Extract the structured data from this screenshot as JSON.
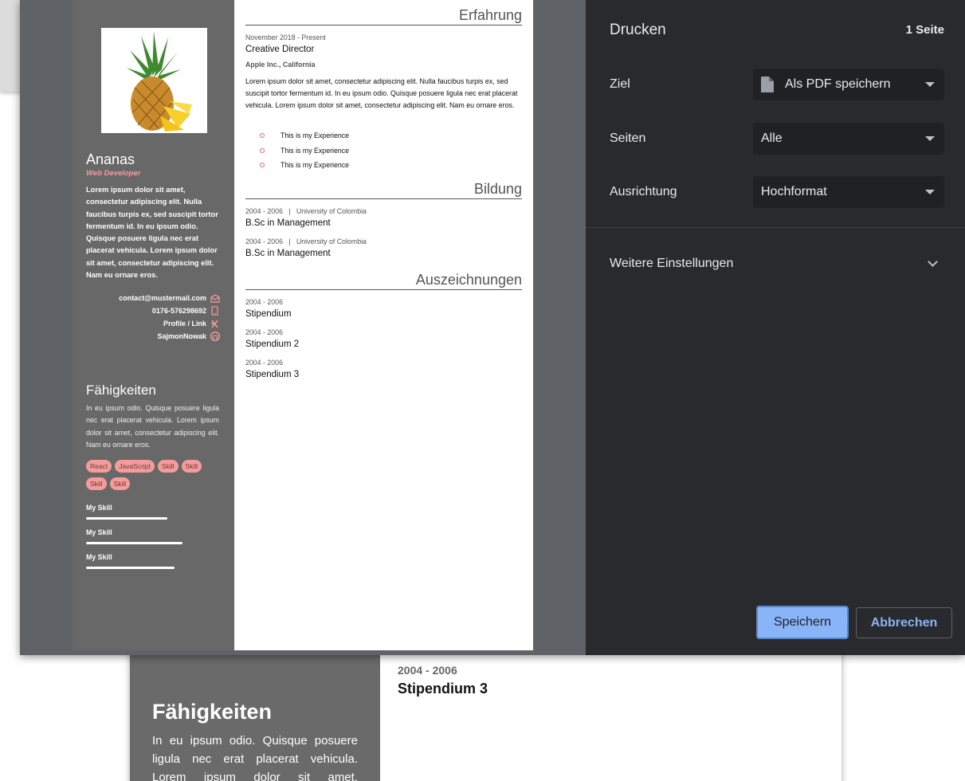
{
  "background_page": {
    "skills_title": "Fähigkeiten",
    "skills_text": "In eu ipsum odio. Quisque posuere ligula nec erat placerat vehicula. Lorem ipsum dolor sit amet, consectetur",
    "date": "2004 - 2006",
    "title": "Stipendium 3"
  },
  "cv": {
    "sidebar": {
      "name": "Ananas",
      "role": "Web Developer",
      "about": "Lorem ipsum dolor sit amet, consectetur adipiscing elit. Nulla faucibus turpis ex, sed suscipit tortor fermentum id. In eu ipsum odio. Quisque posuere ligula nec erat placerat vehicula. Lorem ipsum dolor sit amet, consectetur adipiscing elit. Nam eu ornare eros.",
      "contacts": [
        {
          "text": "contact@mustermail.com",
          "icon": "mail-icon"
        },
        {
          "text": "0176-576298692",
          "icon": "phone-icon"
        },
        {
          "text": "Profile / Link",
          "icon": "link-icon"
        },
        {
          "text": "SajmonNowak",
          "icon": "github-icon"
        }
      ],
      "skills_title": "Fähigkeiten",
      "skills_text": "In eu ipsum odio. Quisque posuere ligula nec erat placerat vehicula. Lorem ipsum dolor sit amet, consectetur adipiscing elit. Nam eu ornare eros.",
      "tags": [
        "React",
        "JavaScript",
        "Skill",
        "Skill",
        "Skill",
        "Skill"
      ],
      "skill_bars": [
        {
          "label": "My Skill",
          "level": 0.6
        },
        {
          "label": "My Skill",
          "level": 0.71
        },
        {
          "label": "My Skill",
          "level": 0.65
        }
      ],
      "accent_color": "#f49c9c"
    },
    "main": {
      "experience_heading": "Erfahrung",
      "experience": {
        "date": "November 2018 - Present",
        "title": "Creative Director",
        "company": "Apple Inc., California",
        "description": "Lorem ipsum dolor sit amet, consectetur adipiscing elit. Nulla faucibus turpis ex, sed suscipit tortor fermentum id. In eu ipsum odio. Quisque posuere ligula nec erat placerat vehicula. Lorem ipsum dolor sit amet, consectetur adipiscing elit. Nam eu ornare eros.",
        "bullets": [
          "This is my Experience",
          "This is my Experience",
          "This is my Experience"
        ]
      },
      "education_heading": "Bildung",
      "education": [
        {
          "date": "2004 - 2006",
          "school": "University of Colombia",
          "degree": "B.Sc in Management"
        },
        {
          "date": "2004 - 2006",
          "school": "University of Colombia",
          "degree": "B.Sc in Management"
        }
      ],
      "awards_heading": "Auszeichnungen",
      "awards": [
        {
          "date": "2004 - 2006",
          "title": "Stipendium"
        },
        {
          "date": "2004 - 2006",
          "title": "Stipendium 2"
        },
        {
          "date": "2004 - 2006",
          "title": "Stipendium 3"
        }
      ]
    }
  },
  "print": {
    "title": "Drucken",
    "page_count": "1 Seite",
    "destination_label": "Ziel",
    "destination_value": "Als PDF speichern",
    "pages_label": "Seiten",
    "pages_value": "Alle",
    "orientation_label": "Ausrichtung",
    "orientation_value": "Hochformat",
    "more_settings": "Weitere Einstellungen",
    "save_button": "Speichern",
    "cancel_button": "Abbrechen",
    "accent_color": "#8ab4f8"
  }
}
